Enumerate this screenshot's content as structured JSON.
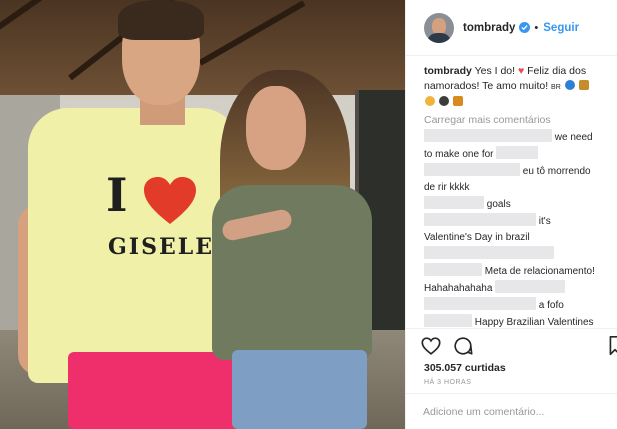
{
  "header": {
    "username": "tombrady",
    "separator": "•",
    "follow_label": "Seguir"
  },
  "photo": {
    "shirt_letter": "I",
    "shirt_name": "GISELE"
  },
  "caption": {
    "username": "tombrady",
    "text_1": "Yes I do!",
    "text_2": "Feliz dia dos namorados! Te amo muito!",
    "suffix": "BR"
  },
  "load_more_label": "Carregar mais comentários",
  "comments": [
    {
      "text": "we need to make one for"
    },
    {
      "text": "eu tô morrendo de rir kkkk"
    },
    {
      "text": "goals"
    },
    {
      "text": "it's Valentine's Day in brazil"
    },
    {
      "text": ""
    },
    {
      "text": "Meta de relacionamento! Hahahahahaha"
    },
    {
      "text": "a fofo"
    },
    {
      "text": "Happy Brazilian Valentines"
    }
  ],
  "actions": {
    "likes": "305.057 curtidas",
    "time": "HÁ 3 HORAS"
  },
  "add_comment": {
    "placeholder": "Adicione um comentário..."
  },
  "colors": {
    "accent": "#3897f0",
    "like": "#ed4956",
    "muted": "#999999",
    "text": "#262626"
  }
}
